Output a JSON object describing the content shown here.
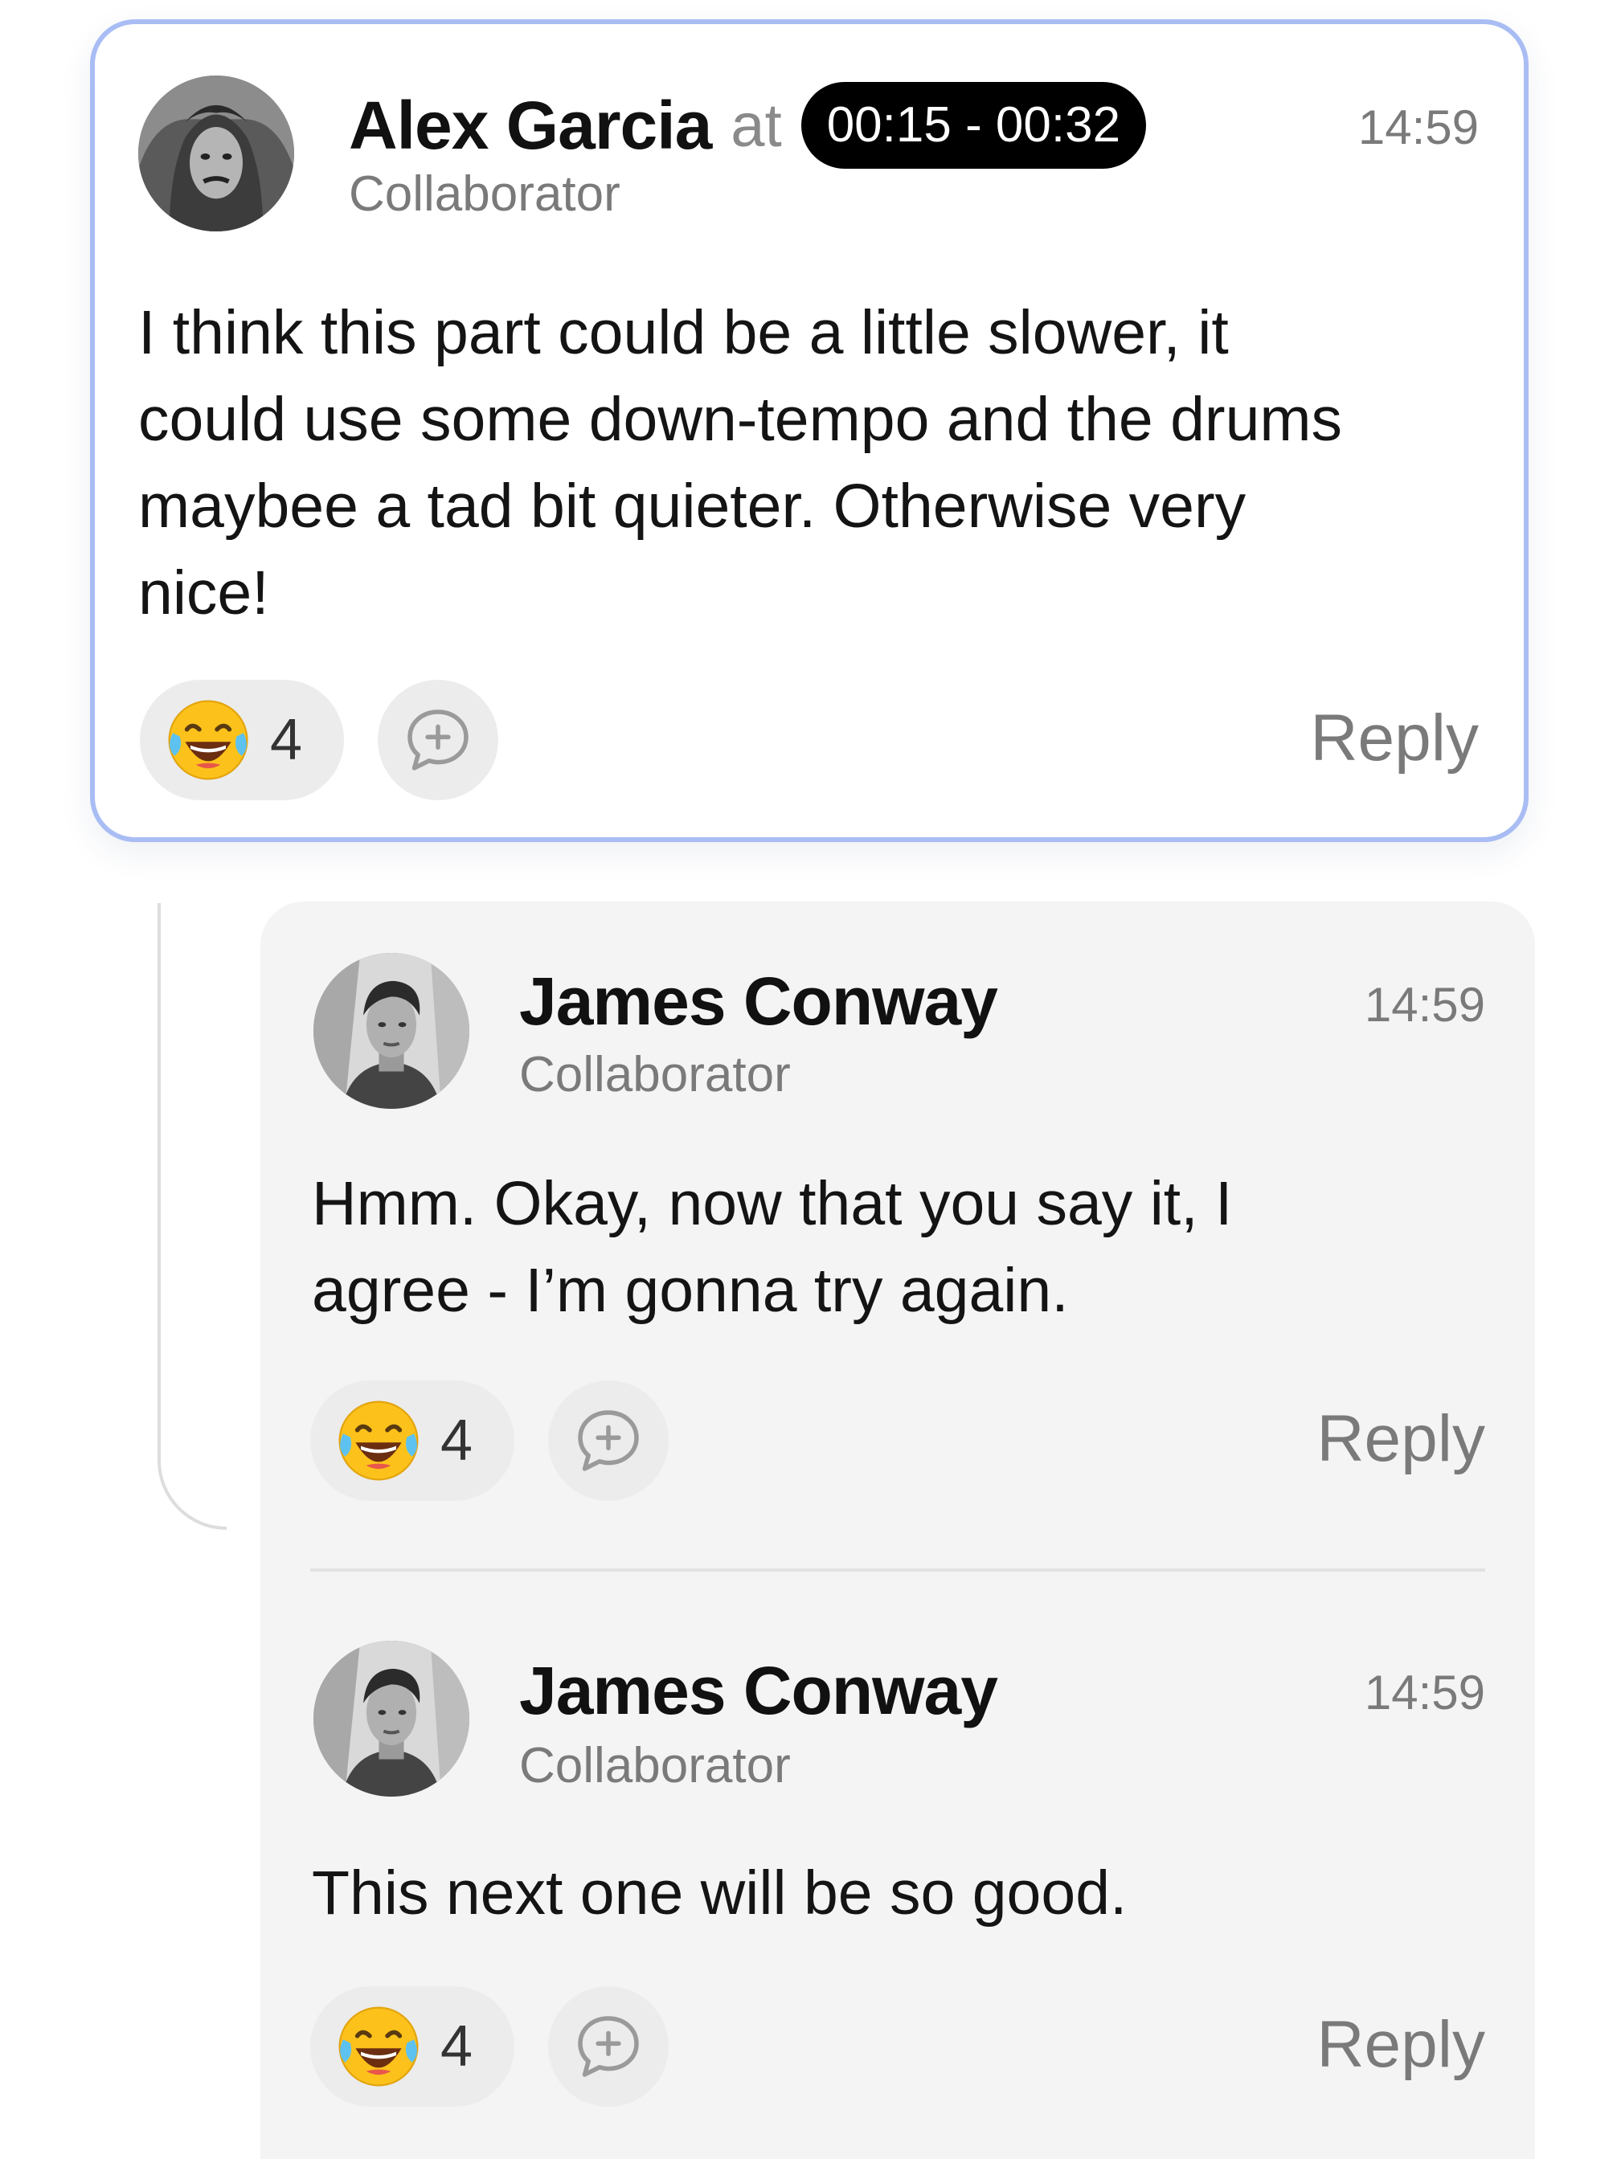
{
  "main_comment": {
    "author": "Alex Garcia",
    "at_word": "at",
    "time_range": "00:15 - 00:32",
    "role": "Collaborator",
    "timestamp": "14:59",
    "lines": [
      "I think this part could be a little slower, it",
      "could use some down-tempo and the drums",
      "maybee a tad bit quieter. Otherwise very",
      "nice!"
    ],
    "reaction": {
      "emoji": "tears-of-joy-emoji",
      "count": "4"
    },
    "reply_label": "Reply"
  },
  "replies": [
    {
      "author": "James Conway",
      "role": "Collaborator",
      "timestamp": "14:59",
      "lines": [
        "Hmm. Okay, now that you say it, I",
        "agree - I’m gonna try again."
      ],
      "reaction": {
        "emoji": "tears-of-joy-emoji",
        "count": "4"
      },
      "reply_label": "Reply"
    },
    {
      "author": "James Conway",
      "role": "Collaborator",
      "timestamp": "14:59",
      "lines": [
        "This next one will be so good."
      ],
      "reaction": {
        "emoji": "tears-of-joy-emoji",
        "count": "4"
      },
      "reply_label": "Reply"
    }
  ],
  "colors": {
    "card_border": "#a9bdf4",
    "reply_panel": "#f4f4f4",
    "pill_bg": "#ececec",
    "time_pill_bg": "#000000",
    "muted_text": "#7a7a7a"
  },
  "icons": {
    "add_reaction": "comment-plus-icon",
    "reaction": "tears-of-joy-emoji"
  }
}
